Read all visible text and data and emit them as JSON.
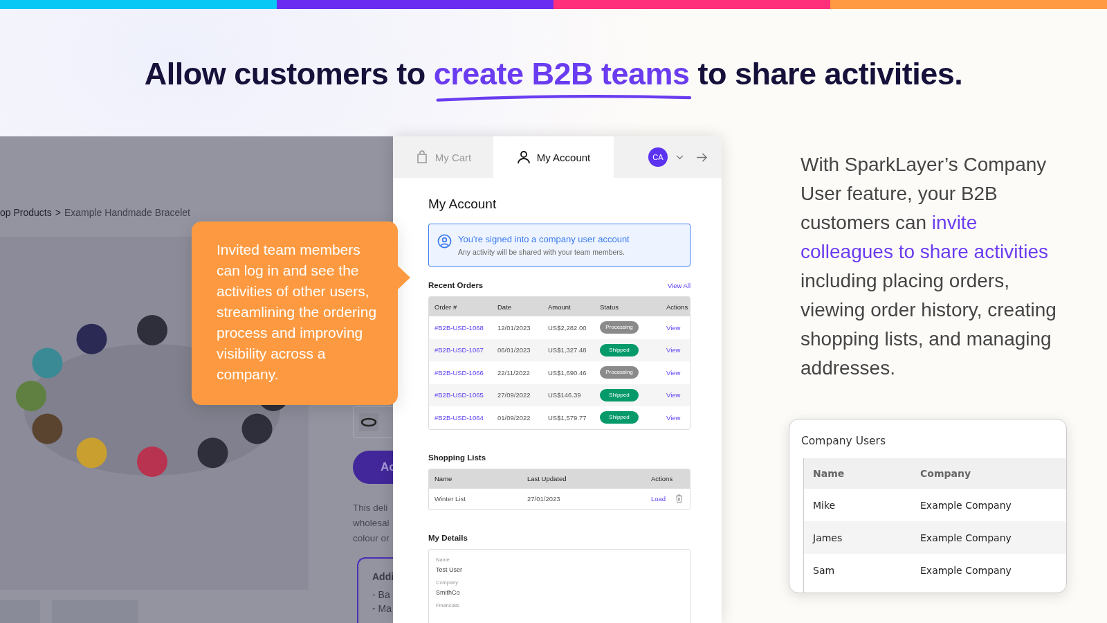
{
  "headline": {
    "before": "Allow customers to ",
    "highlight": "create B2B teams",
    "after": " to share activities."
  },
  "product_page": {
    "breadcrumb": [
      "op Products",
      "Example Handmade Bracelet"
    ],
    "separator": ">",
    "photo": {
      "kind": "picture"
    },
    "button": "Ac",
    "description": [
      "This deli",
      "wholesal",
      "colour or"
    ],
    "info_box": {
      "title": "Addi",
      "items": [
        "- Ba",
        "- Ma"
      ]
    }
  },
  "callout": "Invited team members can log in and see the activities of other users, streamlining the ordering process and improving visibility across a company.",
  "account_panel": {
    "tabs": [
      {
        "label": "My Cart",
        "selected": false
      },
      {
        "label": "My Account",
        "selected": true
      }
    ],
    "avatar": "CA",
    "title": "My Account",
    "notice": {
      "title": "You're signed into a company user account",
      "text": "Any activity will be shared with your team members."
    },
    "recent_orders": {
      "title": "Recent Orders",
      "link": "View All",
      "columns": [
        "Order #",
        "Date",
        "Amount",
        "Status",
        "Actions"
      ],
      "rows": [
        {
          "order": "#B2B-USD-1068",
          "date": "12/01/2023",
          "amount": "US$2,282.00",
          "status": {
            "label": "Processing",
            "kind": "processing"
          },
          "action": "View"
        },
        {
          "order": "#B2B-USD-1067",
          "date": "06/01/2023",
          "amount": "US$1,327.48",
          "status": {
            "label": "Shipped",
            "kind": "shipped"
          },
          "action": "View"
        },
        {
          "order": "#B2B-USD-1066",
          "date": "22/11/2022",
          "amount": "US$1,690.46",
          "status": {
            "label": "Processing",
            "kind": "processing"
          },
          "action": "View"
        },
        {
          "order": "#B2B-USD-1065",
          "date": "27/09/2022",
          "amount": "US$146.39",
          "status": {
            "label": "Shipped",
            "kind": "shipped"
          },
          "action": "View"
        },
        {
          "order": "#B2B-USD-1064",
          "date": "01/09/2022",
          "amount": "US$1,579.77",
          "status": {
            "label": "Shipped",
            "kind": "shipped"
          },
          "action": "View"
        }
      ]
    },
    "shopping_lists": {
      "title": "Shopping Lists",
      "columns": [
        "Name",
        "Last Updated",
        "Actions"
      ],
      "rows": [
        {
          "name": "Winter List",
          "updated": "27/01/2023",
          "action": "Load"
        }
      ]
    },
    "details": {
      "title": "My Details",
      "fields": [
        {
          "label": "Name",
          "value": "Test User"
        },
        {
          "label": "Company",
          "value": "SmithCo"
        },
        {
          "label": "Financials"
        }
      ]
    }
  },
  "description": {
    "before": "With SparkLayer’s Company User feature, your B2B customers can ",
    "highlight": "invite colleagues to share activities",
    "after": " including placing orders, viewing order history, creating shopping lists, and managing addresses."
  },
  "company_users": {
    "title": "Company Users",
    "columns": [
      "Name",
      "Company"
    ],
    "rows": [
      {
        "name": "Mike",
        "company": "Example Company"
      },
      {
        "name": "James",
        "company": "Example Company"
      },
      {
        "name": "Sam",
        "company": "Example Company"
      }
    ]
  }
}
